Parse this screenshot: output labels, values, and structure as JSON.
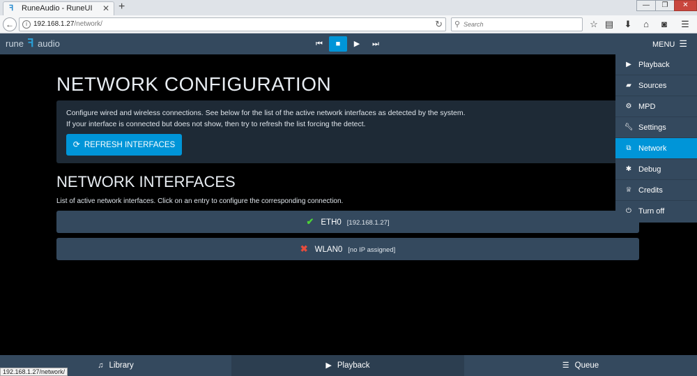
{
  "browser": {
    "tab_title": "RuneAudio - RuneUI",
    "url_host": "192.168.1.27",
    "url_path": "/network/",
    "search_placeholder": "Search",
    "status_url": "192.168.1.27/network/"
  },
  "header": {
    "logo_left": "rune",
    "logo_right": "audio",
    "menu_label": "MENU"
  },
  "page": {
    "title": "NETWORK CONFIGURATION",
    "info_line1": "Configure wired and wireless connections. See below for the list of the active network interfaces as detected by the system.",
    "info_line2": "If your interface is connected but does not show, then try to refresh the list forcing the detect.",
    "refresh_button": "REFRESH INTERFACES",
    "interfaces_title": "NETWORK INTERFACES",
    "interfaces_subtitle": "List of active network interfaces. Click on an entry to configure the corresponding connection.",
    "interfaces": [
      {
        "name": "ETH0",
        "ip": "[192.168.1.27]",
        "status": "connected"
      },
      {
        "name": "WLAN0",
        "ip": "[no IP assigned]",
        "status": "disconnected"
      }
    ]
  },
  "menu": {
    "items": [
      {
        "label": "Playback",
        "icon": "play-icon"
      },
      {
        "label": "Sources",
        "icon": "folder-icon"
      },
      {
        "label": "MPD",
        "icon": "cogs-icon"
      },
      {
        "label": "Settings",
        "icon": "wrench-icon"
      },
      {
        "label": "Network",
        "icon": "sitemap-icon",
        "active": true
      },
      {
        "label": "Debug",
        "icon": "bug-icon"
      },
      {
        "label": "Credits",
        "icon": "trophy-icon"
      },
      {
        "label": "Turn off",
        "icon": "power-icon"
      }
    ]
  },
  "bottom": {
    "library": "Library",
    "playback": "Playback",
    "queue": "Queue"
  },
  "colors": {
    "accent": "#0095d8",
    "panel": "#34495e",
    "background": "#000000",
    "ok": "#4cd137",
    "error": "#e74c3c"
  }
}
